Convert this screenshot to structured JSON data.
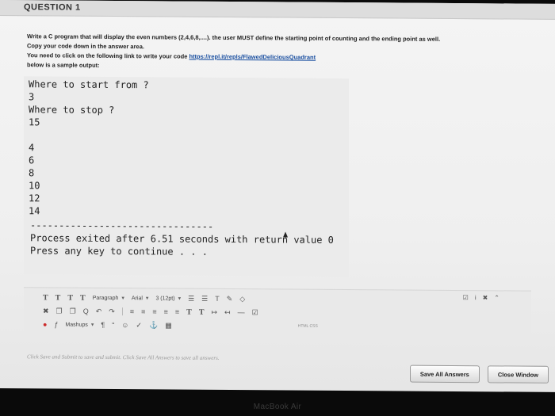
{
  "question": {
    "title": "QUESTION 1"
  },
  "instructions": {
    "line1": "Write a C program that will display the even numbers (2,4,6,8,....). the user MUST define the starting point of counting and the ending point as well.",
    "line2": "Copy your code down in the answer area.",
    "line3_prefix": "You need to click on the following link to write your code ",
    "link": "https://repl.it/repls/FlawedDeliciousQuadrant",
    "line4": "below is a sample output:"
  },
  "terminal": {
    "lines": [
      "Where to start from ?",
      "3",
      "Where to stop ?",
      "15",
      "",
      "4",
      "6",
      "8",
      "10",
      "12",
      "14"
    ],
    "separator": "--------------------------------",
    "exit_line": "Process exited after 6.51 seconds with return value 0",
    "continue_line": "Press any key to continue . . ."
  },
  "toolbar": {
    "row1": {
      "format_buttons": [
        "T",
        "T",
        "T",
        "T"
      ],
      "paragraph_label": "Paragraph",
      "font_label": "Arial",
      "size_label": "3 (12pt)",
      "right_icons": [
        "☑",
        "i",
        "✖",
        "⌃"
      ]
    },
    "row2": {
      "icons": [
        "✖",
        "❐",
        "❐",
        "Q",
        "↶",
        "↷"
      ],
      "align_icons": [
        "≡",
        "≡",
        "≡",
        "≡",
        "≡"
      ],
      "script_buttons": [
        "T",
        "T"
      ]
    },
    "row3": {
      "mashups_label": "Mashups",
      "icons": [
        "¶",
        "“",
        "☺",
        "✓",
        "⚓",
        "▦"
      ],
      "html_label": "HTML CSS"
    }
  },
  "hint": "Click Save and Submit to save and submit. Click Save All Answers to save all answers.",
  "buttons": {
    "save_all": "Save All Answers",
    "close_window": "Close Window"
  },
  "device": {
    "label": "MacBook Air"
  }
}
